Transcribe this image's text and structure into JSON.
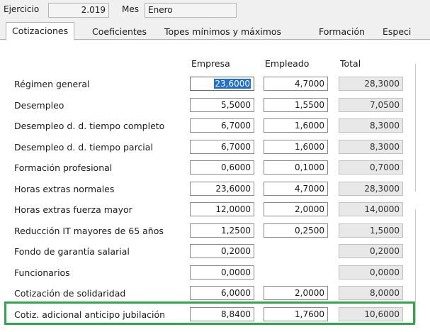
{
  "header": {
    "ejercicio_label": "Ejercicio",
    "ejercicio_value": "2.019",
    "mes_label": "Mes",
    "mes_value": "Enero"
  },
  "tabs": [
    {
      "label": "Cotizaciones",
      "active": true
    },
    {
      "label": "Coeficientes",
      "active": false
    },
    {
      "label": "Topes mínimos y máximos",
      "active": false
    },
    {
      "label": "Formación",
      "active": false
    },
    {
      "label": "Especi",
      "active": false
    }
  ],
  "columns": [
    "Empresa",
    "Empleado",
    "Total"
  ],
  "rows": [
    {
      "label": "Régimen general",
      "empresa": "23,6000",
      "empleado": "4,7000",
      "total": "28,3000"
    },
    {
      "label": "Desempleo",
      "empresa": "5,5000",
      "empleado": "1,5500",
      "total": "7,0500"
    },
    {
      "label": "Desempleo d. d. tiempo completo",
      "empresa": "6,7000",
      "empleado": "1,6000",
      "total": "8,3000"
    },
    {
      "label": "Desempleo d. d. tiempo parcial",
      "empresa": "6,7000",
      "empleado": "1,6000",
      "total": "8,3000"
    },
    {
      "label": "Formación profesional",
      "empresa": "0,6000",
      "empleado": "0,1000",
      "total": "0,7000"
    },
    {
      "label": "Horas extras normales",
      "empresa": "23,6000",
      "empleado": "4,7000",
      "total": "28,3000"
    },
    {
      "label": "Horas extras fuerza mayor",
      "empresa": "12,0000",
      "empleado": "2,0000",
      "total": "14,0000"
    },
    {
      "label": "Reducción IT mayores de 65 años",
      "empresa": "1,2500",
      "empleado": "0,2500",
      "total": "1,5000"
    },
    {
      "label": "Fondo de garantía salarial",
      "empresa": "0,2000",
      "empleado": null,
      "total": "0,2000"
    },
    {
      "label": "Funcionarios",
      "empresa": "0,0000",
      "empleado": null,
      "total": "0,0000"
    },
    {
      "label": "Cotización de solidaridad",
      "empresa": "6,0000",
      "empleado": "2,0000",
      "total": "8,0000"
    },
    {
      "label": "Cotiz. adicional anticipo jubilación",
      "empresa": "8,8400",
      "empleado": "1,7600",
      "total": "10,6000"
    }
  ],
  "colors": {
    "highlight": "#2ea84a",
    "selection": "#1e6fd1"
  }
}
